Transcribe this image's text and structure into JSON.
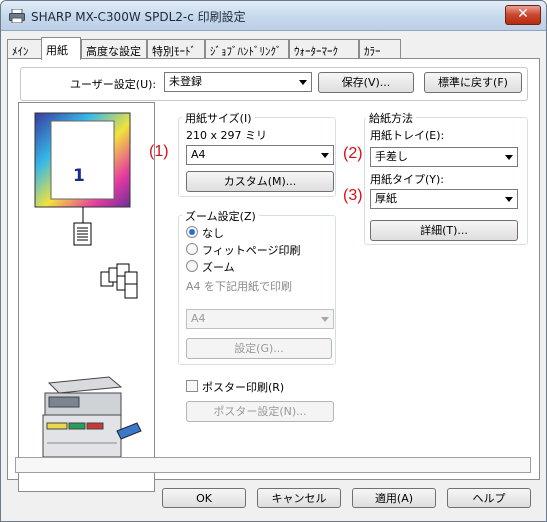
{
  "window": {
    "title": "SHARP MX-C300W SPDL2-c 印刷設定",
    "close_label": "✕"
  },
  "tabs": [
    {
      "label": "ﾒｲﾝ"
    },
    {
      "label": "用紙"
    },
    {
      "label": "高度な設定"
    },
    {
      "label": "特別ﾓｰﾄﾞ"
    },
    {
      "label": "ｼﾞｮﾌﾞﾊﾝﾄﾞﾘﾝｸﾞ"
    },
    {
      "label": "ｳｫｰﾀｰﾏｰｸ"
    },
    {
      "label": "ｶﾗｰ"
    }
  ],
  "user_settings": {
    "label": "ユーザー設定(U):",
    "value": "未登録",
    "save_label": "保存(V)...",
    "reset_label": "標準に戻す(F)"
  },
  "preview": {
    "page_number": "1"
  },
  "paper_size": {
    "title": "用紙サイズ(I)",
    "dimensions": "210 x 297 ミリ",
    "value": "A4",
    "custom_label": "カスタム(M)..."
  },
  "paper_source": {
    "title": "給紙方法",
    "tray_label": "用紙トレイ(E):",
    "tray_value": "手差し",
    "type_label": "用紙タイプ(Y):",
    "type_value": "厚紙",
    "details_label": "詳細(T)..."
  },
  "zoom": {
    "title": "ズーム設定(Z)",
    "options": [
      "なし",
      "フィットページ印刷",
      "ズーム"
    ],
    "selected": "なし",
    "fit_caption": "A4 を下記用紙で印刷",
    "fit_value": "A4",
    "settings_label": "設定(G)..."
  },
  "poster": {
    "checkbox_label": "ポスター印刷(R)",
    "checked": false,
    "settings_label": "ポスター設定(N)..."
  },
  "markers": [
    "(1)",
    "(2)",
    "(3)"
  ],
  "footer": {
    "ok": "OK",
    "cancel": "キャンセル",
    "apply": "適用(A)",
    "help": "ヘルプ"
  }
}
